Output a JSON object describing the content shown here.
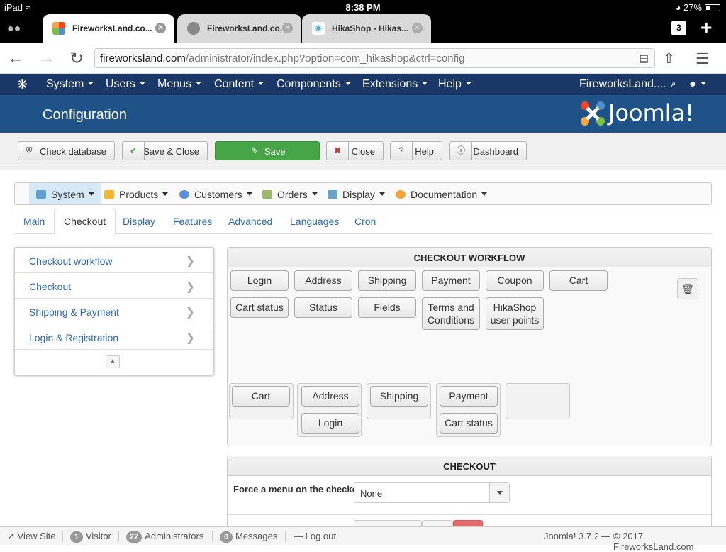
{
  "device_status": {
    "device": "iPad",
    "time": "8:38 PM",
    "battery": "27%"
  },
  "browser": {
    "tabs": [
      {
        "title": "FireworksLand.co..."
      },
      {
        "title": "FireworksLand.co..."
      },
      {
        "title": "HikaShop - Hikas..."
      }
    ],
    "tab_count": "3",
    "url_host": "fireworksland.com",
    "url_path": "/administrator/index.php?option=com_hikashop&ctrl=config"
  },
  "admin_nav": {
    "items": [
      "System",
      "Users",
      "Menus",
      "Content",
      "Components",
      "Extensions",
      "Help"
    ],
    "site_link": "FireworksLand....",
    "user_icon": "user-icon"
  },
  "header": {
    "title": "Configuration",
    "logo_text": "Joomla!"
  },
  "toolbar": {
    "check_database": "Check database",
    "save_close": "Save & Close",
    "save": "Save",
    "close": "Close",
    "help": "Help",
    "dashboard": "Dashboard"
  },
  "hika_menu": [
    "System",
    "Products",
    "Customers",
    "Orders",
    "Display",
    "Documentation"
  ],
  "sub_tabs": [
    "Main",
    "Checkout",
    "Display",
    "Features",
    "Advanced",
    "Languages",
    "Cron"
  ],
  "side_nav": [
    "Checkout workflow",
    "Checkout",
    "Shipping & Payment",
    "Login & Registration"
  ],
  "workflow": {
    "title": "CHECKOUT WORKFLOW",
    "available_row1": [
      "Login",
      "Address",
      "Shipping",
      "Payment",
      "Coupon",
      "Cart"
    ],
    "available_row2": [
      "Cart status",
      "Status",
      "Fields",
      "Terms and Conditions",
      "HikaShop user points"
    ],
    "steps": [
      [
        "Cart"
      ],
      [
        "Address",
        "Login"
      ],
      [
        "Shipping"
      ],
      [
        "Payment",
        "Cart status"
      ],
      []
    ]
  },
  "checkout": {
    "title": "CHECKOUT",
    "force_menu_label": "Force a menu on the checkout",
    "force_menu_value": "None"
  },
  "footer": {
    "view_site": "View Site",
    "visitors_count": "1",
    "visitors_label": "Visitor",
    "admins_count": "27",
    "admins_label": "Administrators",
    "messages_count": "0",
    "messages_label": "Messages",
    "logout": "Log out",
    "version": "Joomla! 3.7.2",
    "copyright": "© 2017 FireworksLand.com"
  },
  "colors": {
    "admin_nav": "#1a3867",
    "header": "#1f5287",
    "save_green": "#46a546",
    "link_blue": "#2a69b8"
  }
}
